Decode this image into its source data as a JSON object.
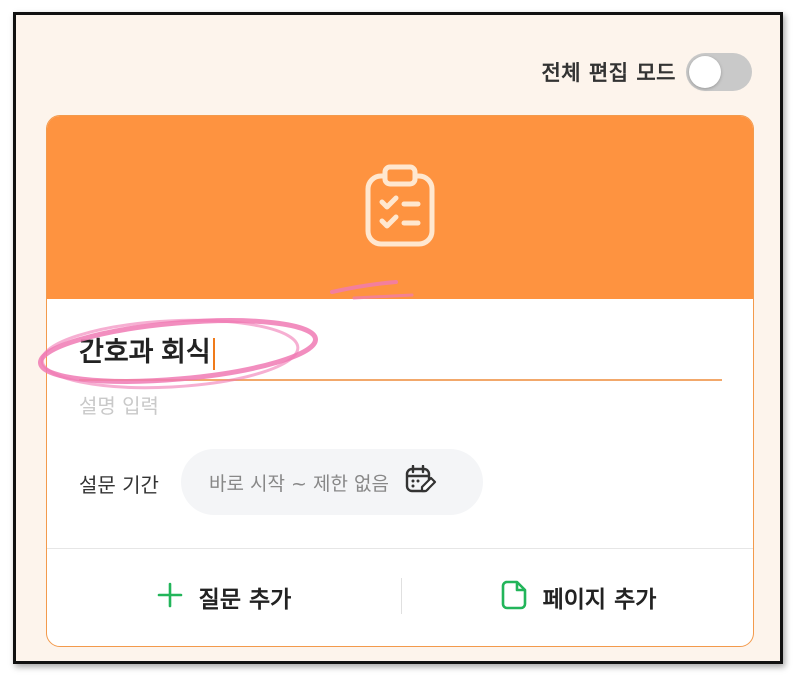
{
  "header": {
    "mode_label": "전체 편집 모드",
    "mode_toggle_on": false
  },
  "survey": {
    "title": "간호과 회식",
    "description_placeholder": "설명 입력",
    "period_label": "설문 기간",
    "period_value": "바로 시작 ~ 제한 없음"
  },
  "actions": {
    "add_question": "질문 추가",
    "add_page": "페이지 추가"
  },
  "icons": {
    "header_icon": "clipboard-checklist-icon",
    "period_icon": "calendar-edit-icon",
    "add_question_icon": "plus-icon",
    "add_page_icon": "page-icon"
  },
  "colors": {
    "header_bg": "#fe9340",
    "accent": "#f07b1a",
    "green": "#22b55a",
    "annotation": "#f07ab4"
  }
}
